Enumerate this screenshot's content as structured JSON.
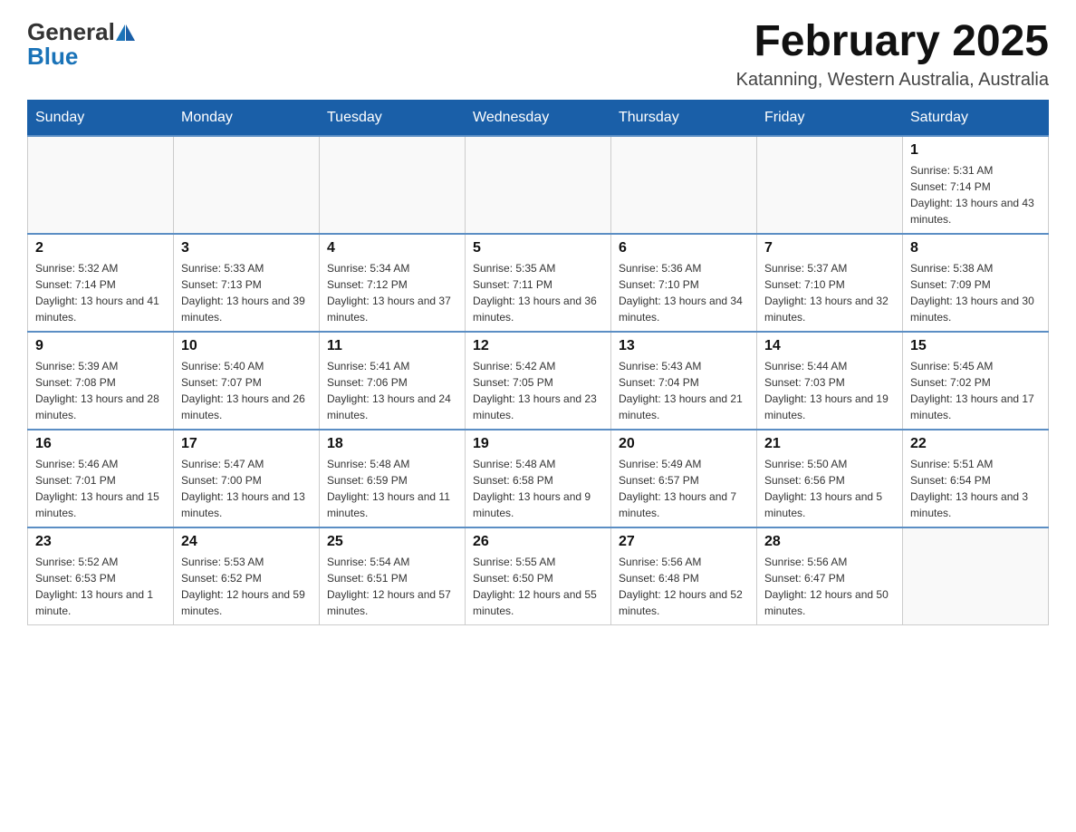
{
  "header": {
    "logo_general": "General",
    "logo_blue": "Blue",
    "month_title": "February 2025",
    "location": "Katanning, Western Australia, Australia"
  },
  "days_of_week": [
    "Sunday",
    "Monday",
    "Tuesday",
    "Wednesday",
    "Thursday",
    "Friday",
    "Saturday"
  ],
  "weeks": [
    [
      {
        "num": "",
        "info": ""
      },
      {
        "num": "",
        "info": ""
      },
      {
        "num": "",
        "info": ""
      },
      {
        "num": "",
        "info": ""
      },
      {
        "num": "",
        "info": ""
      },
      {
        "num": "",
        "info": ""
      },
      {
        "num": "1",
        "info": "Sunrise: 5:31 AM\nSunset: 7:14 PM\nDaylight: 13 hours and 43 minutes."
      }
    ],
    [
      {
        "num": "2",
        "info": "Sunrise: 5:32 AM\nSunset: 7:14 PM\nDaylight: 13 hours and 41 minutes."
      },
      {
        "num": "3",
        "info": "Sunrise: 5:33 AM\nSunset: 7:13 PM\nDaylight: 13 hours and 39 minutes."
      },
      {
        "num": "4",
        "info": "Sunrise: 5:34 AM\nSunset: 7:12 PM\nDaylight: 13 hours and 37 minutes."
      },
      {
        "num": "5",
        "info": "Sunrise: 5:35 AM\nSunset: 7:11 PM\nDaylight: 13 hours and 36 minutes."
      },
      {
        "num": "6",
        "info": "Sunrise: 5:36 AM\nSunset: 7:10 PM\nDaylight: 13 hours and 34 minutes."
      },
      {
        "num": "7",
        "info": "Sunrise: 5:37 AM\nSunset: 7:10 PM\nDaylight: 13 hours and 32 minutes."
      },
      {
        "num": "8",
        "info": "Sunrise: 5:38 AM\nSunset: 7:09 PM\nDaylight: 13 hours and 30 minutes."
      }
    ],
    [
      {
        "num": "9",
        "info": "Sunrise: 5:39 AM\nSunset: 7:08 PM\nDaylight: 13 hours and 28 minutes."
      },
      {
        "num": "10",
        "info": "Sunrise: 5:40 AM\nSunset: 7:07 PM\nDaylight: 13 hours and 26 minutes."
      },
      {
        "num": "11",
        "info": "Sunrise: 5:41 AM\nSunset: 7:06 PM\nDaylight: 13 hours and 24 minutes."
      },
      {
        "num": "12",
        "info": "Sunrise: 5:42 AM\nSunset: 7:05 PM\nDaylight: 13 hours and 23 minutes."
      },
      {
        "num": "13",
        "info": "Sunrise: 5:43 AM\nSunset: 7:04 PM\nDaylight: 13 hours and 21 minutes."
      },
      {
        "num": "14",
        "info": "Sunrise: 5:44 AM\nSunset: 7:03 PM\nDaylight: 13 hours and 19 minutes."
      },
      {
        "num": "15",
        "info": "Sunrise: 5:45 AM\nSunset: 7:02 PM\nDaylight: 13 hours and 17 minutes."
      }
    ],
    [
      {
        "num": "16",
        "info": "Sunrise: 5:46 AM\nSunset: 7:01 PM\nDaylight: 13 hours and 15 minutes."
      },
      {
        "num": "17",
        "info": "Sunrise: 5:47 AM\nSunset: 7:00 PM\nDaylight: 13 hours and 13 minutes."
      },
      {
        "num": "18",
        "info": "Sunrise: 5:48 AM\nSunset: 6:59 PM\nDaylight: 13 hours and 11 minutes."
      },
      {
        "num": "19",
        "info": "Sunrise: 5:48 AM\nSunset: 6:58 PM\nDaylight: 13 hours and 9 minutes."
      },
      {
        "num": "20",
        "info": "Sunrise: 5:49 AM\nSunset: 6:57 PM\nDaylight: 13 hours and 7 minutes."
      },
      {
        "num": "21",
        "info": "Sunrise: 5:50 AM\nSunset: 6:56 PM\nDaylight: 13 hours and 5 minutes."
      },
      {
        "num": "22",
        "info": "Sunrise: 5:51 AM\nSunset: 6:54 PM\nDaylight: 13 hours and 3 minutes."
      }
    ],
    [
      {
        "num": "23",
        "info": "Sunrise: 5:52 AM\nSunset: 6:53 PM\nDaylight: 13 hours and 1 minute."
      },
      {
        "num": "24",
        "info": "Sunrise: 5:53 AM\nSunset: 6:52 PM\nDaylight: 12 hours and 59 minutes."
      },
      {
        "num": "25",
        "info": "Sunrise: 5:54 AM\nSunset: 6:51 PM\nDaylight: 12 hours and 57 minutes."
      },
      {
        "num": "26",
        "info": "Sunrise: 5:55 AM\nSunset: 6:50 PM\nDaylight: 12 hours and 55 minutes."
      },
      {
        "num": "27",
        "info": "Sunrise: 5:56 AM\nSunset: 6:48 PM\nDaylight: 12 hours and 52 minutes."
      },
      {
        "num": "28",
        "info": "Sunrise: 5:56 AM\nSunset: 6:47 PM\nDaylight: 12 hours and 50 minutes."
      },
      {
        "num": "",
        "info": ""
      }
    ]
  ]
}
